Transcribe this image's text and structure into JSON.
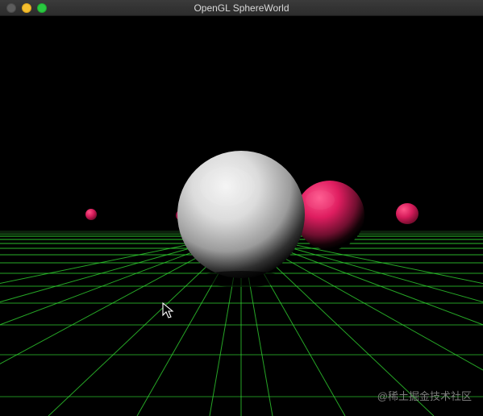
{
  "window": {
    "title": "OpenGL SphereWorld",
    "controls": {
      "close": "close-button",
      "minimize": "minimize-button",
      "maximize": "zoom-button"
    }
  },
  "scene": {
    "background": "#000000",
    "floor_grid_color": "#33dd33",
    "large_sphere_color": "#e0e0e0",
    "small_sphere_color": "#d81b5c"
  },
  "watermark": "@稀土掘金技术社区",
  "cursor_icon": "arrow-cursor-icon"
}
